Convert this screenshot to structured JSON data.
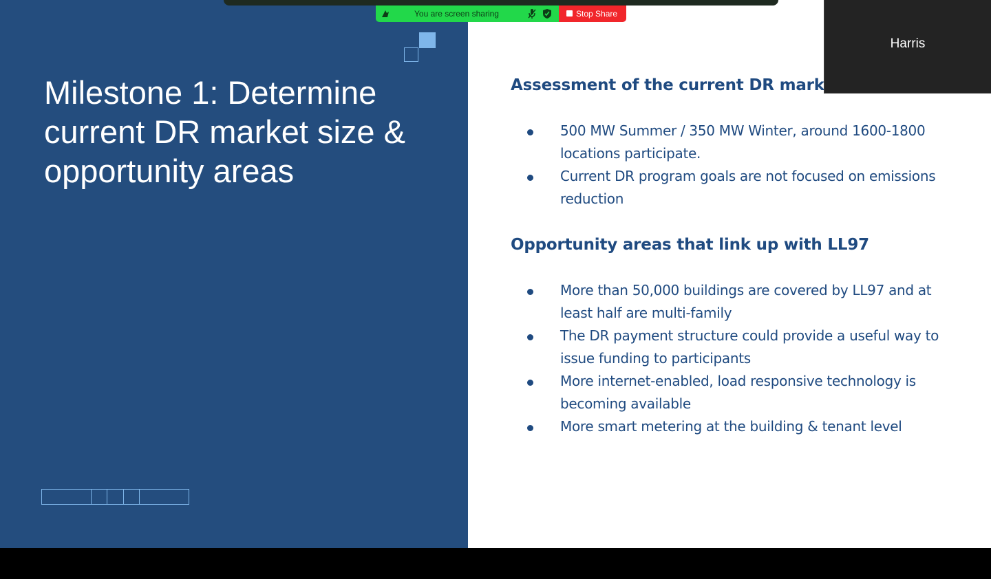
{
  "slide": {
    "title": "Milestone 1: Determine current DR market size & opportunity areas",
    "sections": [
      {
        "heading": "Assessment of the current DR market:",
        "bullets": [
          "500 MW Summer / 350 MW Winter, around 1600-1800 locations participate.",
          "Current DR program goals are not focused on emissions reduction"
        ]
      },
      {
        "heading": "Opportunity areas that link up with LL97",
        "bullets": [
          "More than 50,000 buildings are covered by LL97 and at least half are multi-family",
          "The DR payment structure could provide a useful way to issue funding to participants",
          "More internet-enabled, load responsive technology is becoming available",
          "More smart metering at the building & tenant level"
        ]
      }
    ]
  },
  "sharing_bar": {
    "status_text": "You are screen sharing",
    "stop_label": "Stop Share"
  },
  "participant": {
    "name": "Harris"
  },
  "colors": {
    "left_panel": "#244d7e",
    "accent_light_blue": "#7fb6ea",
    "body_text": "#1f4a80",
    "sharing_green": "#22d84a",
    "stop_red": "#f1262b"
  },
  "icons": [
    "screen-share-icon",
    "mic-icon",
    "shield-icon",
    "stop-icon"
  ]
}
